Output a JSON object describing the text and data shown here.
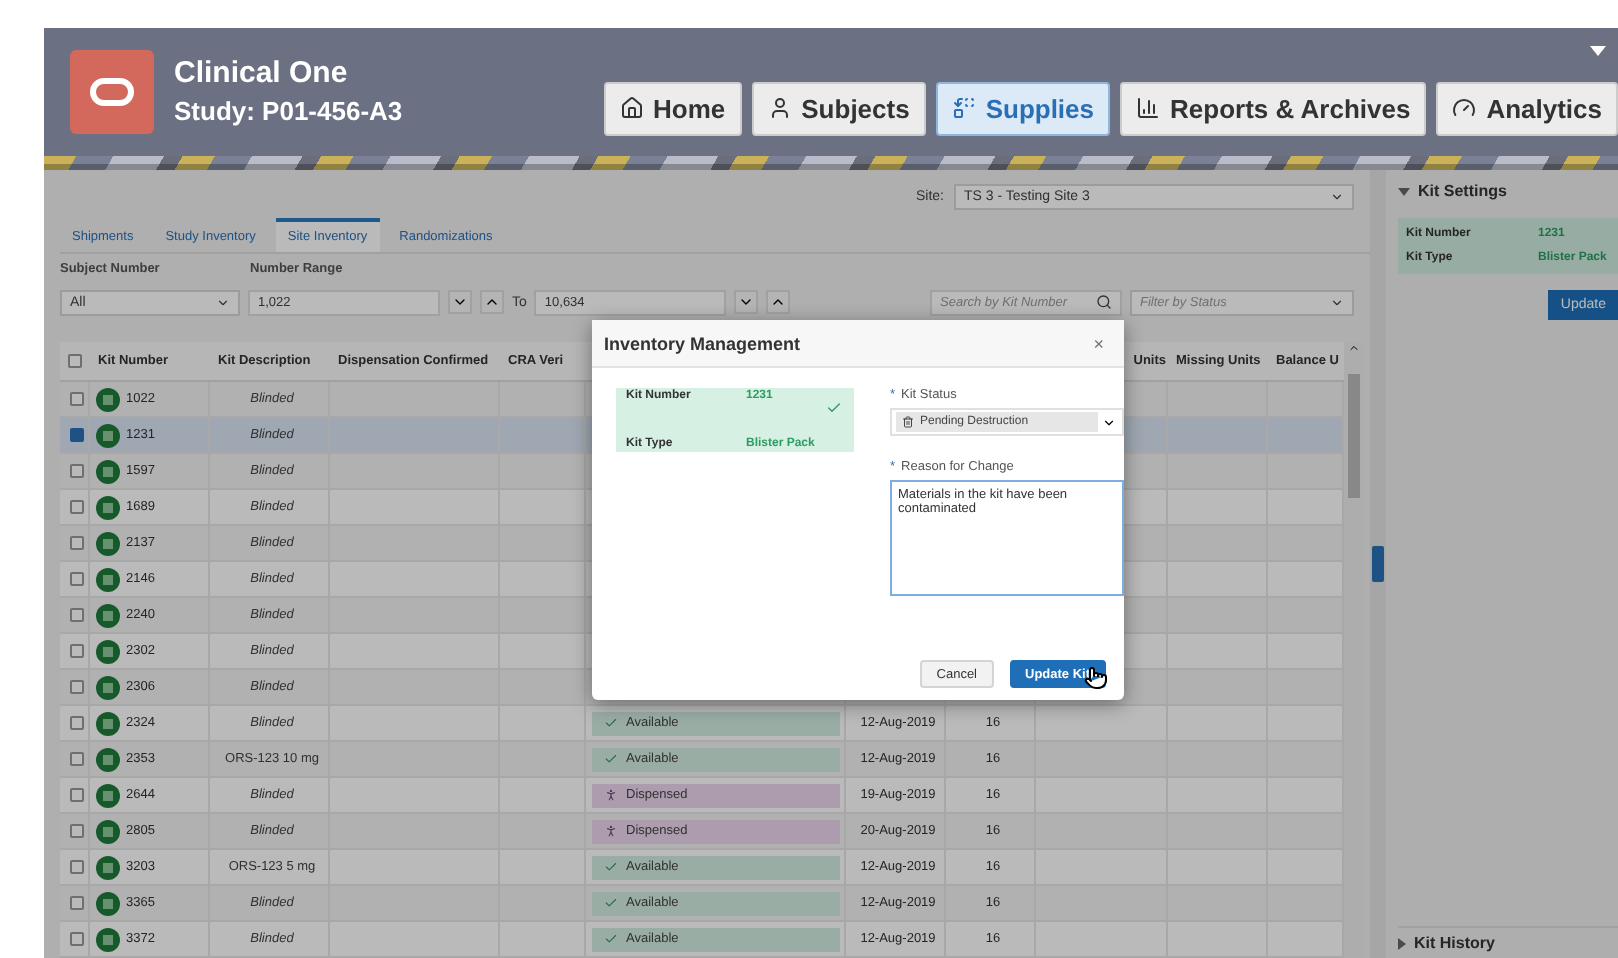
{
  "header": {
    "app_name": "Clinical One",
    "study": "Study: P01-456-A3",
    "nav": [
      {
        "kind": "home",
        "label": "Home",
        "selected": false
      },
      {
        "kind": "subjects",
        "label": "Subjects",
        "selected": false
      },
      {
        "kind": "supplies",
        "label": "Supplies",
        "selected": true
      },
      {
        "kind": "reports",
        "label": "Reports & Archives",
        "selected": false
      },
      {
        "kind": "analytics",
        "label": "Analytics",
        "selected": false
      }
    ]
  },
  "site": {
    "label": "Site:",
    "value": "TS 3 - Testing Site 3"
  },
  "tabs": [
    {
      "label": "Shipments",
      "selected": false
    },
    {
      "label": "Study Inventory",
      "selected": false
    },
    {
      "label": "Site Inventory",
      "selected": true
    },
    {
      "label": "Randomizations",
      "selected": false
    }
  ],
  "filters": {
    "subject_label": "Subject Number",
    "subject_value": "All",
    "range_label": "Number Range",
    "range_from": "1,022",
    "range_to_label": "To",
    "range_to": "10,634",
    "search_placeholder": "Search by Kit Number",
    "status_placeholder": "Filter by Status"
  },
  "table": {
    "select_all_checked": false,
    "columns_left": [
      "Kit Number",
      "Kit Description",
      "Dispensation Confirmed",
      "CRA Veri"
    ],
    "columns_right": [
      "Units",
      "Missing Units",
      "Balance U"
    ],
    "rows": [
      {
        "checked": false,
        "kit_number": "1022",
        "description": "Blinded",
        "blinded": true
      },
      {
        "checked": true,
        "kit_number": "1231",
        "description": "Blinded",
        "blinded": true
      },
      {
        "checked": false,
        "kit_number": "1597",
        "description": "Blinded",
        "blinded": true
      },
      {
        "checked": false,
        "kit_number": "1689",
        "description": "Blinded",
        "blinded": true
      },
      {
        "checked": false,
        "kit_number": "2137",
        "description": "Blinded",
        "blinded": true
      },
      {
        "checked": false,
        "kit_number": "2146",
        "description": "Blinded",
        "blinded": true
      },
      {
        "checked": false,
        "kit_number": "2240",
        "description": "Blinded",
        "blinded": true
      },
      {
        "checked": false,
        "kit_number": "2302",
        "description": "Blinded",
        "blinded": true
      },
      {
        "checked": false,
        "kit_number": "2306",
        "description": "Blinded",
        "blinded": true
      },
      {
        "checked": false,
        "kit_number": "2324",
        "description": "Blinded",
        "blinded": true,
        "status": {
          "kind": "available",
          "label": "Available"
        },
        "date": "12-Aug-2019",
        "units": "16"
      },
      {
        "checked": false,
        "kit_number": "2353",
        "description": "ORS-123 10 mg",
        "blinded": false,
        "status": {
          "kind": "available",
          "label": "Available"
        },
        "date": "12-Aug-2019",
        "units": "16"
      },
      {
        "checked": false,
        "kit_number": "2644",
        "description": "Blinded",
        "blinded": true,
        "status": {
          "kind": "dispensed",
          "label": "Dispensed"
        },
        "date": "19-Aug-2019",
        "units": "16"
      },
      {
        "checked": false,
        "kit_number": "2805",
        "description": "Blinded",
        "blinded": true,
        "status": {
          "kind": "dispensed",
          "label": "Dispensed"
        },
        "date": "20-Aug-2019",
        "units": "16"
      },
      {
        "checked": false,
        "kit_number": "3203",
        "description": "ORS-123 5 mg",
        "blinded": false,
        "status": {
          "kind": "available",
          "label": "Available"
        },
        "date": "12-Aug-2019",
        "units": "16"
      },
      {
        "checked": false,
        "kit_number": "3365",
        "description": "Blinded",
        "blinded": true,
        "status": {
          "kind": "available",
          "label": "Available"
        },
        "date": "12-Aug-2019",
        "units": "16"
      },
      {
        "checked": false,
        "kit_number": "3372",
        "description": "Blinded",
        "blinded": true,
        "status": {
          "kind": "available",
          "label": "Available"
        },
        "date": "12-Aug-2019",
        "units": "16"
      }
    ]
  },
  "kit_settings": {
    "title": "Kit Settings",
    "expanded": true,
    "fields": [
      {
        "label": "Kit Number",
        "value": "1231"
      },
      {
        "label": "Kit Type",
        "value": "Blister Pack"
      }
    ],
    "button": "Update"
  },
  "kit_history": {
    "title": "Kit History",
    "expanded": false
  },
  "dialog": {
    "title": "Inventory Management",
    "close": "×",
    "summary": [
      {
        "label": "Kit Number",
        "value": "1231",
        "verified": true
      },
      {
        "label": "Kit Type",
        "value": "Blister Pack",
        "verified": false
      }
    ],
    "status_field": {
      "required_mark": "*",
      "label": "Kit Status",
      "value": "Pending Destruction"
    },
    "reason_field": {
      "required_mark": "*",
      "label": "Reason for Change",
      "value": "Materials in the kit have been contaminated"
    },
    "buttons": [
      {
        "kind": "secondary",
        "label": "Cancel"
      },
      {
        "kind": "primary",
        "label": "Update Kit"
      }
    ]
  }
}
